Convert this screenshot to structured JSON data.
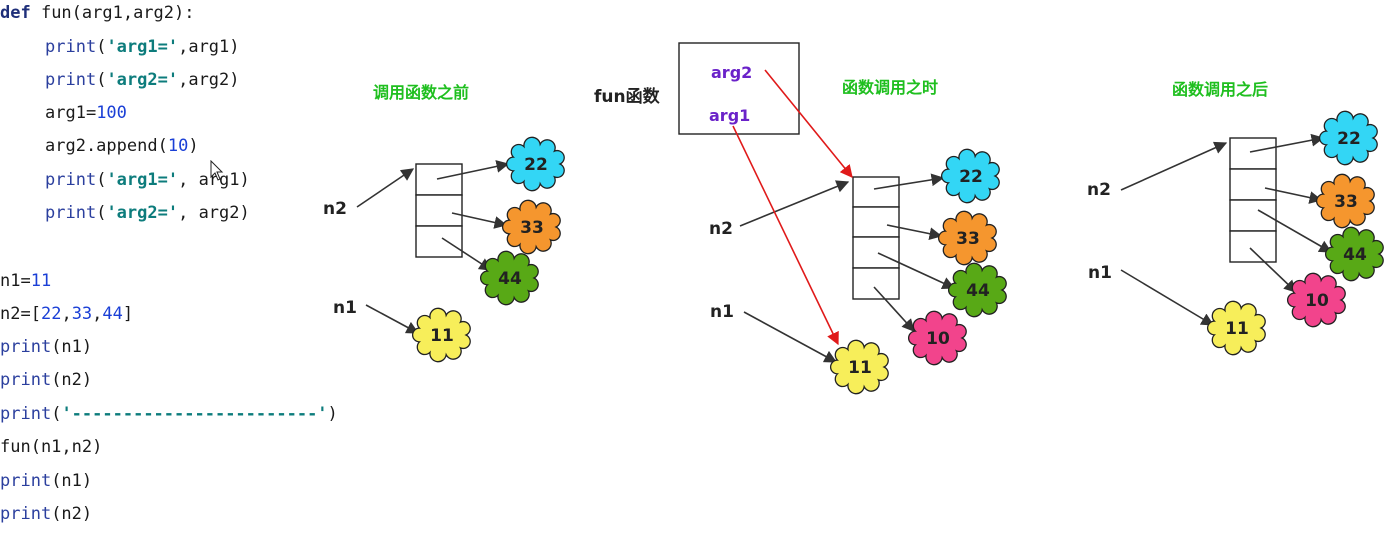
{
  "code": {
    "lines": [
      {
        "indent": false,
        "parts": [
          {
            "t": "kw",
            "v": "def"
          },
          {
            "t": "pl",
            "v": " fun(arg1,arg2):"
          }
        ]
      },
      {
        "indent": true,
        "parts": [
          {
            "t": "fn",
            "v": "print"
          },
          {
            "t": "pl",
            "v": "("
          },
          {
            "t": "str",
            "v": "'arg1='"
          },
          {
            "t": "pl",
            "v": ",arg1)"
          }
        ]
      },
      {
        "indent": true,
        "parts": [
          {
            "t": "fn",
            "v": "print"
          },
          {
            "t": "pl",
            "v": "("
          },
          {
            "t": "str",
            "v": "'arg2='"
          },
          {
            "t": "pl",
            "v": ",arg2)"
          }
        ]
      },
      {
        "indent": true,
        "parts": [
          {
            "t": "pl",
            "v": "arg1="
          },
          {
            "t": "num",
            "v": "100"
          }
        ]
      },
      {
        "indent": true,
        "parts": [
          {
            "t": "pl",
            "v": "arg2.append("
          },
          {
            "t": "num",
            "v": "10"
          },
          {
            "t": "pl",
            "v": ")"
          }
        ]
      },
      {
        "indent": true,
        "parts": [
          {
            "t": "fn",
            "v": "print"
          },
          {
            "t": "pl",
            "v": "("
          },
          {
            "t": "str",
            "v": "'arg1='"
          },
          {
            "t": "pl",
            "v": ", arg1)"
          }
        ]
      },
      {
        "indent": true,
        "parts": [
          {
            "t": "fn",
            "v": "print"
          },
          {
            "t": "pl",
            "v": "("
          },
          {
            "t": "str",
            "v": "'arg2='"
          },
          {
            "t": "pl",
            "v": ", arg2)"
          }
        ]
      },
      {
        "indent": false,
        "parts": []
      },
      {
        "indent": false,
        "parts": [
          {
            "t": "pl",
            "v": "n1="
          },
          {
            "t": "num",
            "v": "11"
          }
        ]
      },
      {
        "indent": false,
        "parts": [
          {
            "t": "pl",
            "v": "n2=["
          },
          {
            "t": "num",
            "v": "22"
          },
          {
            "t": "pl",
            "v": ","
          },
          {
            "t": "num",
            "v": "33"
          },
          {
            "t": "pl",
            "v": ","
          },
          {
            "t": "num",
            "v": "44"
          },
          {
            "t": "pl",
            "v": "]"
          }
        ]
      },
      {
        "indent": false,
        "parts": [
          {
            "t": "fn",
            "v": "print"
          },
          {
            "t": "pl",
            "v": "(n1)"
          }
        ]
      },
      {
        "indent": false,
        "parts": [
          {
            "t": "fn",
            "v": "print"
          },
          {
            "t": "pl",
            "v": "(n2)"
          }
        ]
      },
      {
        "indent": false,
        "parts": [
          {
            "t": "fn",
            "v": "print"
          },
          {
            "t": "pl",
            "v": "("
          },
          {
            "t": "str",
            "v": "'------------------------'"
          },
          {
            "t": "pl",
            "v": ")"
          }
        ]
      },
      {
        "indent": false,
        "parts": [
          {
            "t": "pl",
            "v": "fun(n1,n2)"
          }
        ]
      },
      {
        "indent": false,
        "parts": [
          {
            "t": "fn",
            "v": "print"
          },
          {
            "t": "pl",
            "v": "(n1)"
          }
        ]
      },
      {
        "indent": false,
        "parts": [
          {
            "t": "fn",
            "v": "print"
          },
          {
            "t": "pl",
            "v": "(n2)"
          }
        ]
      }
    ]
  },
  "diagram": {
    "before": {
      "title": "调用函数之前",
      "n2_label": "n2",
      "n1_label": "n1",
      "list_values": [
        "22",
        "33",
        "44"
      ],
      "n1_value": "11"
    },
    "during": {
      "title": "函数调用之时",
      "func_label": "fun函数",
      "arg2_label": "arg2",
      "arg1_label": "arg1",
      "n2_label": "n2",
      "n1_label": "n1",
      "list_values": [
        "22",
        "33",
        "44",
        "10"
      ],
      "n1_value": "11"
    },
    "after": {
      "title": "函数调用之后",
      "n2_label": "n2",
      "n1_label": "n1",
      "list_values": [
        "22",
        "33",
        "44",
        "10"
      ],
      "n1_value": "11"
    },
    "colors": {
      "v22": "#33d6f5",
      "v33": "#f5962e",
      "v44": "#58a916",
      "v10": "#f2448c",
      "v11": "#f7ee5a",
      "title": "#1fbf1f",
      "arg": "#6a22c9",
      "red_arrow": "#e01a1a"
    }
  }
}
